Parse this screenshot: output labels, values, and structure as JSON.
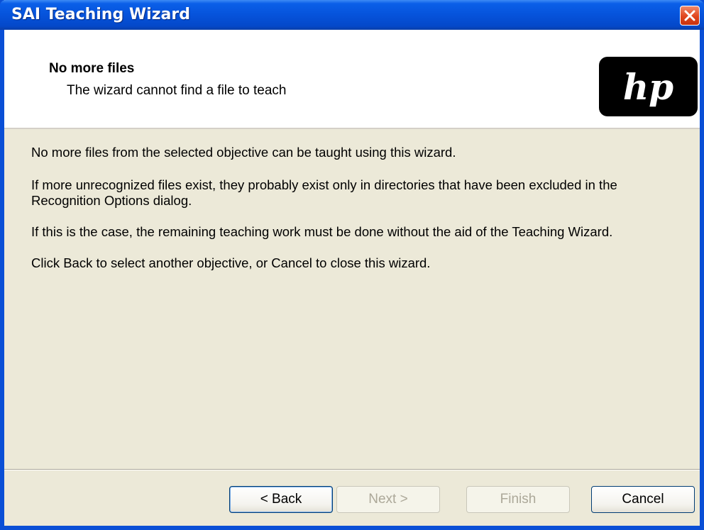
{
  "window": {
    "title": "SAI Teaching Wizard",
    "close_icon": "close-icon"
  },
  "header": {
    "title": "No more files",
    "subtitle": "The wizard cannot find a file to teach",
    "logo_text": "hp"
  },
  "body": {
    "paragraphs": [
      "No more files from the selected objective can be taught using this wizard.",
      "If more unrecognized files exist, they probably exist only in directories that have been excluded in the Recognition Options dialog.",
      "If this is the case, the remaining teaching work must be done without the aid of the Teaching Wizard.",
      "Click Back to select another objective, or Cancel to close this wizard."
    ]
  },
  "buttons": {
    "back": "< Back",
    "next": "Next >",
    "finish": "Finish",
    "cancel": "Cancel"
  },
  "colors": {
    "titlebar": "#0653db",
    "close_button": "#e0461e",
    "dialog_background": "#ece9d8",
    "header_background": "#ffffff"
  }
}
